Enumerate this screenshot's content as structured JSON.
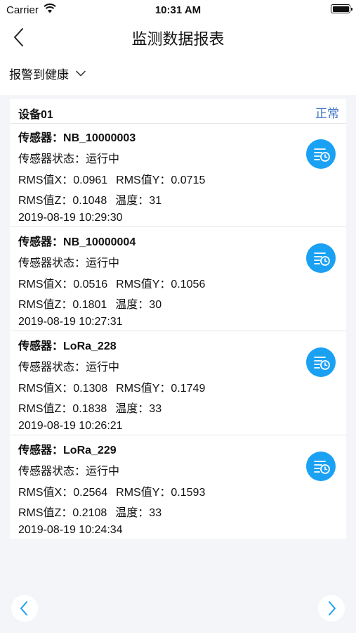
{
  "status_bar": {
    "carrier": "Carrier",
    "time": "10:31 AM"
  },
  "nav": {
    "title": "监测数据报表"
  },
  "filter": {
    "label": "报警到健康"
  },
  "device": {
    "name": "设备01",
    "status": "正常"
  },
  "labels": {
    "sensor_prefix": "传感器：",
    "state_prefix": "传感器状态：",
    "rms_x": "RMS值X：",
    "rms_y": "RMS值Y：",
    "rms_z": "RMS值Z：",
    "temp": "温度："
  },
  "sensors": [
    {
      "id": "NB_10000003",
      "state": "运行中",
      "rms_x": "0.0961",
      "rms_y": "0.0715",
      "rms_z": "0.1048",
      "temp": "31",
      "time": "2019-08-19 10:29:30"
    },
    {
      "id": "NB_10000004",
      "state": "运行中",
      "rms_x": "0.0516",
      "rms_y": "0.1056",
      "rms_z": "0.1801",
      "temp": "30",
      "time": "2019-08-19 10:27:31"
    },
    {
      "id": "LoRa_228",
      "state": "运行中",
      "rms_x": "0.1308",
      "rms_y": "0.1749",
      "rms_z": "0.1838",
      "temp": "33",
      "time": "2019-08-19 10:26:21"
    },
    {
      "id": "LoRa_229",
      "state": "运行中",
      "rms_x": "0.2564",
      "rms_y": "0.1593",
      "rms_z": "0.2108",
      "temp": "33",
      "time": "2019-08-19 10:24:34"
    }
  ],
  "colors": {
    "accent": "#1aa1f3",
    "status_text": "#3a6fc6",
    "background": "#f3f5f8"
  },
  "icons": {
    "back": "chevron-left-icon",
    "dropdown": "chevron-down-icon",
    "history": "history-clock-icon",
    "prev_page": "chevron-left-icon",
    "next_page": "chevron-right-icon"
  }
}
